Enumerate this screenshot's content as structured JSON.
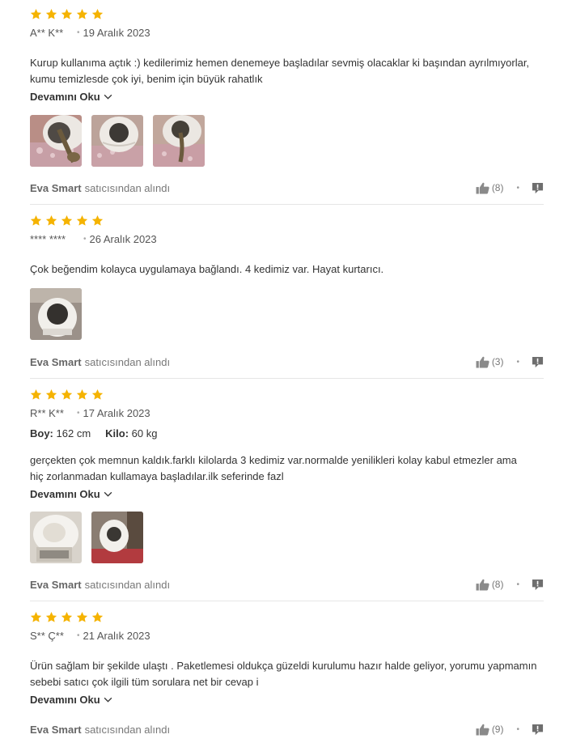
{
  "colors": {
    "star": "#f5b301",
    "text": "#333333",
    "muted": "#777777",
    "divider": "#e6e6e6"
  },
  "icons": {
    "star": "star-icon",
    "more": "chevron-down-icon",
    "like": "thumbs-up-icon",
    "report": "report-icon"
  },
  "reviews": [
    {
      "rating": 5,
      "author": "A** K**",
      "date": "19 Aralık 2023",
      "text_lines": [
        "Kurup kullanıma açtık :) kedilerimiz hemen denemeye başladılar sevmiş olacaklar ki başından ayrılmıyorlar,",
        "kumu temizlesde çok iyi, benim için büyük rahatlık"
      ],
      "more_label": "Devamını Oku",
      "photo_count": 3,
      "seller": "Eva Smart",
      "seller_suffix": "satıcısından alındı",
      "likes": "(8)"
    },
    {
      "rating": 5,
      "author": "**** ****",
      "date": "26 Aralık 2023",
      "text_lines": [
        "Çok beğendim kolayca uygulamaya bağlandı. 4 kedimiz var. Hayat kurtarıcı."
      ],
      "photo_count": 1,
      "seller": "Eva Smart",
      "seller_suffix": "satıcısından alındı",
      "likes": "(3)"
    },
    {
      "rating": 5,
      "author": "R** K**",
      "date": "17 Aralık 2023",
      "attributes": [
        {
          "label": "Boy:",
          "value": "162 cm"
        },
        {
          "label": "Kilo:",
          "value": "60 kg"
        }
      ],
      "text_lines": [
        "gerçekten çok memnun kaldık.farklı kilolarda 3 kedimiz var.normalde yenilikleri kolay kabul etmezler ama",
        "hiç zorlanmadan kullamaya başladılar.ilk seferinde fazl"
      ],
      "more_label": "Devamını Oku",
      "photo_count": 2,
      "seller": "Eva Smart",
      "seller_suffix": "satıcısından alındı",
      "likes": "(8)"
    },
    {
      "rating": 5,
      "author": "S** Ç**",
      "date": "21 Aralık 2023",
      "text_lines": [
        "Ürün sağlam bir şekilde ulaştı . Paketlemesi oldukça güzeldi kurulumu hazır halde geliyor, yorumu yapmamın",
        "sebebi satıcı çok ilgili tüm sorulara net bir cevap i"
      ],
      "more_label": "Devamını Oku",
      "seller": "Eva Smart",
      "seller_suffix": "satıcısından alındı",
      "likes": "(9)"
    }
  ]
}
